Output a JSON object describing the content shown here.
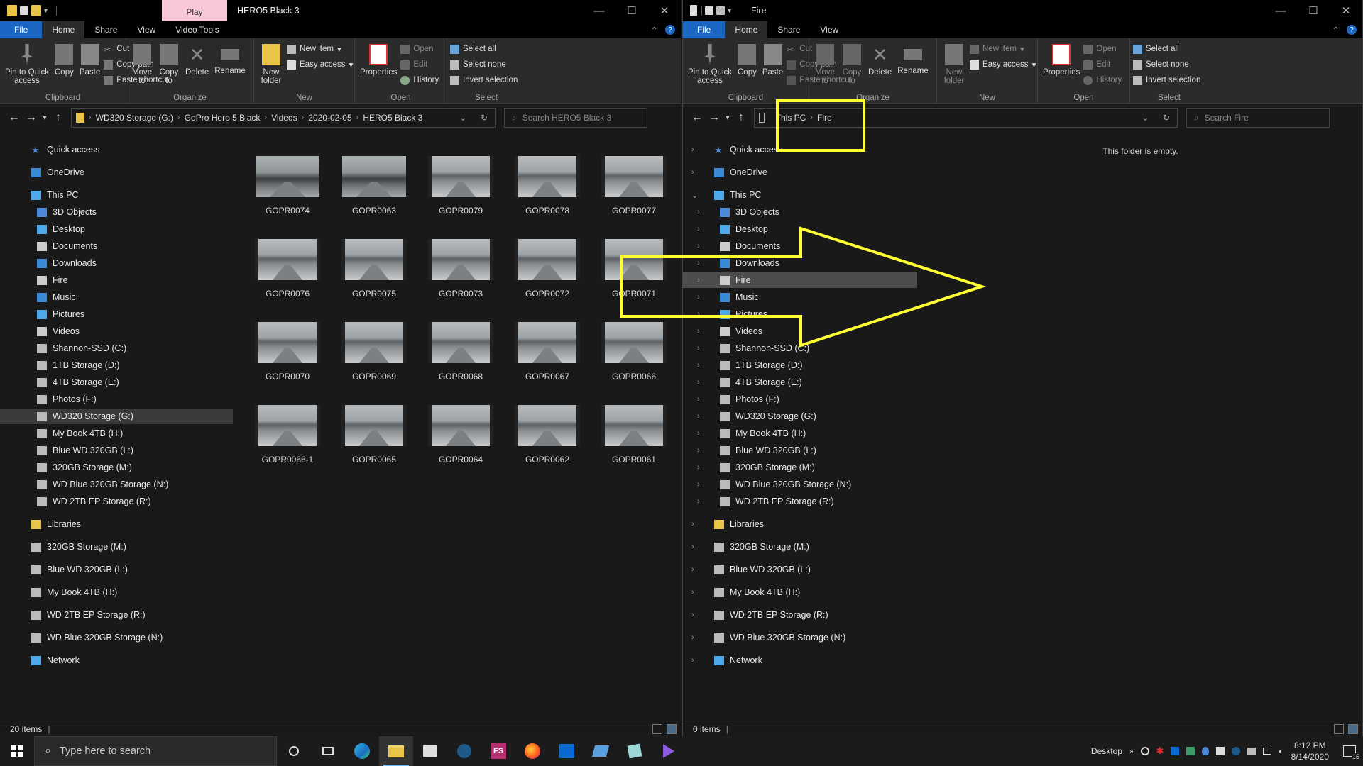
{
  "left_window": {
    "play_tab": "Play",
    "title": "HERO5 Black 3",
    "tabs": [
      "File",
      "Home",
      "Share",
      "View",
      "Video Tools"
    ],
    "ribbon": {
      "clipboard": {
        "pin": "Pin to Quick access",
        "copy": "Copy",
        "paste": "Paste",
        "cut": "Cut",
        "copy_path": "Copy path",
        "paste_shortcut": "Paste shortcut",
        "label": "Clipboard"
      },
      "organize": {
        "move": "Move to",
        "copy_to": "Copy to",
        "delete": "Delete",
        "rename": "Rename",
        "label": "Organize"
      },
      "new": {
        "new_folder": "New folder",
        "new_item": "New item",
        "easy_access": "Easy access",
        "label": "New"
      },
      "open": {
        "properties": "Properties",
        "open": "Open",
        "edit": "Edit",
        "history": "History",
        "label": "Open"
      },
      "select": {
        "select_all": "Select all",
        "select_none": "Select none",
        "invert": "Invert selection",
        "label": "Select"
      }
    },
    "breadcrumb": [
      "WD320 Storage (G:)",
      "GoPro Hero 5 Black",
      "Videos",
      "2020-02-05",
      "HERO5 Black 3"
    ],
    "search_placeholder": "Search HERO5 Black 3",
    "nav": {
      "quick_access": "Quick access",
      "onedrive": "OneDrive",
      "this_pc": "This PC",
      "pc_items": [
        "3D Objects",
        "Desktop",
        "Documents",
        "Downloads",
        "Fire",
        "Music",
        "Pictures",
        "Videos",
        "Shannon-SSD (C:)",
        "1TB Storage (D:)",
        "4TB Storage (E:)",
        "Photos  (F:)",
        "WD320 Storage (G:)",
        "My Book 4TB (H:)",
        "Blue WD 320GB (L:)",
        "320GB Storage (M:)",
        "WD Blue 320GB Storage (N:)",
        "WD 2TB EP Storage (R:)"
      ],
      "libraries": "Libraries",
      "drives": [
        "320GB Storage (M:)",
        "Blue WD 320GB (L:)",
        "My Book 4TB (H:)",
        "WD 2TB EP Storage (R:)",
        "WD Blue 320GB Storage (N:)"
      ],
      "network": "Network"
    },
    "files": [
      "GOPR0074",
      "GOPR0063",
      "GOPR0079",
      "GOPR0078",
      "GOPR0077",
      "GOPR0076",
      "GOPR0075",
      "GOPR0073",
      "GOPR0072",
      "GOPR0071",
      "GOPR0070",
      "GOPR0069",
      "GOPR0068",
      "GOPR0067",
      "GOPR0066",
      "GOPR0066-1",
      "GOPR0065",
      "GOPR0064",
      "GOPR0062",
      "GOPR0061"
    ],
    "status": "20 items"
  },
  "right_window": {
    "title": "Fire",
    "tabs": [
      "File",
      "Home",
      "Share",
      "View"
    ],
    "breadcrumb": [
      "This PC",
      "Fire"
    ],
    "search_placeholder": "Search Fire",
    "empty_message": "This folder is empty.",
    "status": "0 items"
  },
  "taskbar": {
    "search_placeholder": "Type here to search",
    "desktop_label": "Desktop",
    "time": "8:12 PM",
    "date": "8/14/2020",
    "notification_count": "15"
  },
  "colors": {
    "accent": "#1a66c2",
    "annotation": "#ffff33",
    "play_tab": "#f9c7d6"
  }
}
